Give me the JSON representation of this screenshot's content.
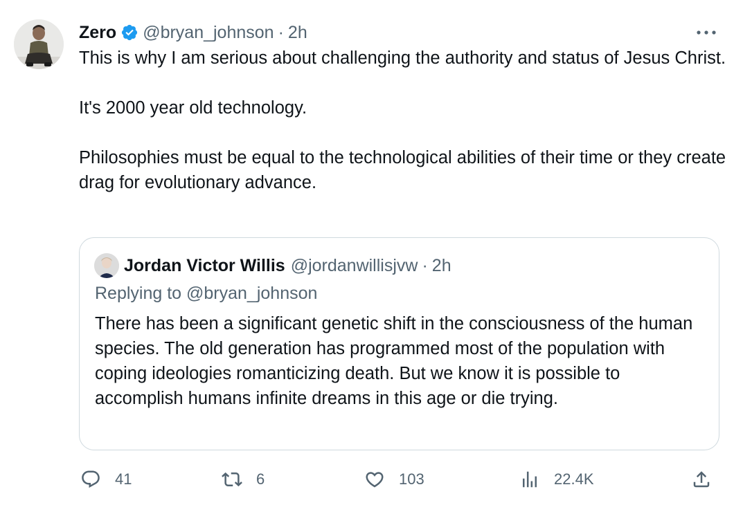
{
  "tweet": {
    "author_name": "Zero",
    "verified": true,
    "handle": "@bryan_johnson",
    "separator": "·",
    "time": "2h",
    "more_icon": "more-horizontal-icon",
    "text": "This is why I am serious about challenging the authority and status of Jesus Christ.\n\nIt's 2000 year old technology.\n\nPhilosophies must be equal to the technological abilities of their time or they create drag for evolutionary advance."
  },
  "quoted_tweet": {
    "author_name": "Jordan Victor Willis",
    "handle": "@jordanwillisjvw",
    "separator": "·",
    "time": "2h",
    "replying_to": "Replying to @bryan_johnson",
    "text": "There has been a significant genetic shift in the consciousness of the human species. The old generation has programmed most of the population with coping ideologies romanticizing death. But we know it is possible to accomplish humans infinite dreams in this age or die trying."
  },
  "actions": {
    "reply": {
      "icon": "reply-icon",
      "count": "41"
    },
    "retweet": {
      "icon": "retweet-icon",
      "count": "6"
    },
    "like": {
      "icon": "heart-icon",
      "count": "103"
    },
    "views": {
      "icon": "analytics-icon",
      "count": "22.4K"
    },
    "share": {
      "icon": "share-icon"
    }
  },
  "colors": {
    "text_primary": "#0f1419",
    "text_secondary": "#536471",
    "verified_blue": "#1d9bf0",
    "border": "#cfd9de",
    "background": "#ffffff"
  }
}
